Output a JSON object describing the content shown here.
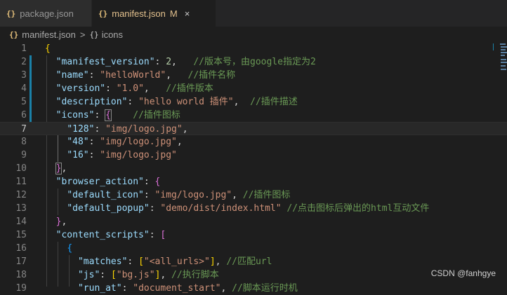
{
  "tabs": [
    {
      "icon": "{}",
      "label": "package.json",
      "modified": ""
    },
    {
      "icon": "{}",
      "label": "manifest.json",
      "modified": "M",
      "close": "×"
    }
  ],
  "breadcrumb": {
    "file": "manifest.json",
    "sep": ">",
    "symbol_icon": "{}",
    "symbol": "icons"
  },
  "line_numbers": [
    "1",
    "2",
    "3",
    "4",
    "5",
    "6",
    "7",
    "8",
    "9",
    "10",
    "11",
    "12",
    "13",
    "14",
    "15",
    "16",
    "17",
    "18",
    "19"
  ],
  "code": {
    "l2": {
      "key": "\"manifest_version\"",
      "val": "2",
      "comment": "//版本号，由google指定为2"
    },
    "l3": {
      "key": "\"name\"",
      "val": "\"helloWorld\"",
      "comment": "//插件名称"
    },
    "l4": {
      "key": "\"version\"",
      "val": "\"1.0\"",
      "comment": "//插件版本"
    },
    "l5": {
      "key": "\"description\"",
      "val": "\"hello world 插件\"",
      "comment": "//插件描述"
    },
    "l6": {
      "key": "\"icons\"",
      "comment": "//插件图标"
    },
    "l7": {
      "key": "\"128\"",
      "val": "\"img/logo.jpg\""
    },
    "l8": {
      "key": "\"48\"",
      "val": "\"img/logo.jpg\""
    },
    "l9": {
      "key": "\"16\"",
      "val": "\"img/logo.jpg\""
    },
    "l11": {
      "key": "\"browser_action\""
    },
    "l12": {
      "key": "\"default_icon\"",
      "val": "\"img/logo.jpg\"",
      "comment": "//插件图标"
    },
    "l13": {
      "key": "\"default_popup\"",
      "val": "\"demo/dist/index.html\"",
      "comment": "//点击图标后弹出的html互动文件"
    },
    "l15": {
      "key": "\"content_scripts\""
    },
    "l17": {
      "key": "\"matches\"",
      "val": "\"<all_urls>\"",
      "comment": "//匹配url"
    },
    "l18": {
      "key": "\"js\"",
      "val": "\"bg.js\"",
      "comment": "//执行脚本"
    },
    "l19": {
      "key": "\"run_at\"",
      "val": "\"document_start\"",
      "comment": "//脚本运行时机"
    }
  },
  "watermark": "CSDN @fanhgye",
  "colors": {
    "key": "#9cdcfe",
    "string": "#ce9178",
    "number": "#b5cea8",
    "comment": "#6a9955",
    "modified_tab": "#e2c08d",
    "git_modified_gutter": "#1b81a8"
  }
}
